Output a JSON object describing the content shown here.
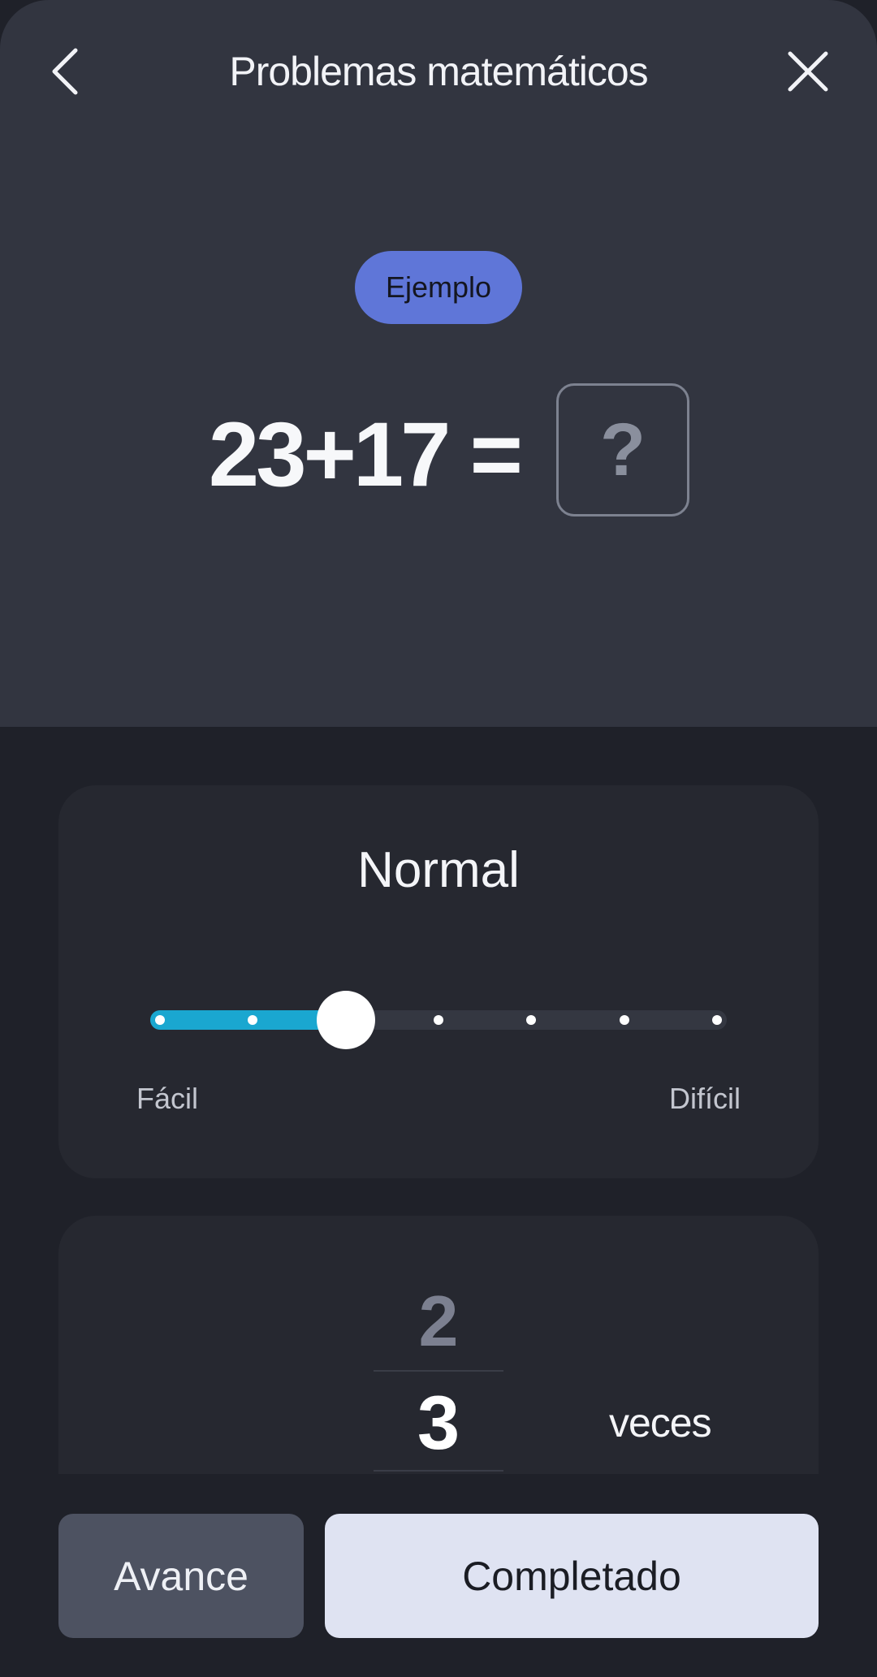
{
  "header": {
    "title": "Problemas matemáticos",
    "back_icon": "chevron-left-icon",
    "close_icon": "close-icon"
  },
  "example": {
    "badge_label": "Ejemplo",
    "equation": "23+17 =",
    "answer_placeholder": "?"
  },
  "difficulty": {
    "title": "Normal",
    "min_label": "Fácil",
    "max_label": "Difícil",
    "steps": 7,
    "selected_step_index": 2
  },
  "repetitions": {
    "previous_value": "2",
    "current_value": "3",
    "unit_label": "veces"
  },
  "actions": {
    "advance_label": "Avance",
    "done_label": "Completado"
  },
  "colors": {
    "accent_badge": "#5f76d8",
    "slider_fill": "#1aa7d0",
    "primary_button": "#dfe3f2",
    "secondary_button": "#4d5261"
  }
}
